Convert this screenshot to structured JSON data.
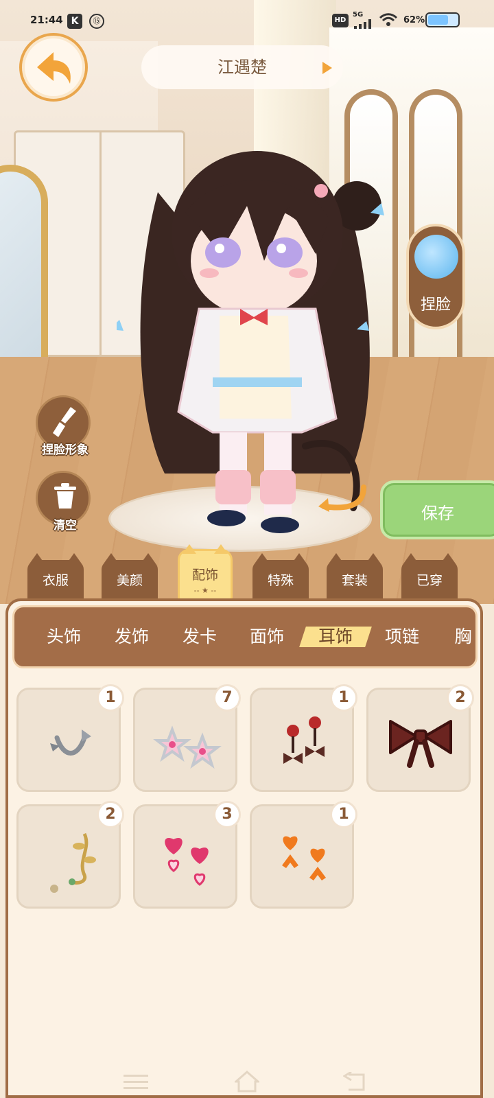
{
  "status": {
    "time": "21:44",
    "k_icon": "K",
    "circle_icon": "⑮",
    "hd": "HD",
    "network": "5G",
    "battery": "62%",
    "battery_level": 0.62
  },
  "header": {
    "back_icon": "back-arrow-icon",
    "character_name": "江遇楚",
    "play_icon": "play-triangle-icon"
  },
  "side_actions": {
    "face_button_label": "捏脸",
    "face_avatar_icon": "chibi-avatar-icon",
    "face_image_label": "捏脸形象",
    "brush_icon": "brush-icon",
    "clear_label": "清空",
    "trash_icon": "trash-icon",
    "save_label": "保存",
    "rotate_icon": "rotate-arrow-icon"
  },
  "categories": [
    {
      "label": "衣服",
      "active": false
    },
    {
      "label": "美颜",
      "active": false
    },
    {
      "label": "配饰",
      "active": true,
      "decoration": "-- ★ --"
    },
    {
      "label": "特殊",
      "active": false
    },
    {
      "label": "套装",
      "active": false
    },
    {
      "label": "已穿",
      "active": false
    }
  ],
  "subcategories": [
    {
      "label": "头饰",
      "active": false
    },
    {
      "label": "发饰",
      "active": false
    },
    {
      "label": "发卡",
      "active": false
    },
    {
      "label": "面饰",
      "active": false
    },
    {
      "label": "耳饰",
      "active": true
    },
    {
      "label": "项链",
      "active": false
    },
    {
      "label": "胸",
      "active": false
    }
  ],
  "items": [
    {
      "count": "1",
      "icon": "silver-hook-earring-icon"
    },
    {
      "count": "7",
      "icon": "pink-star-earring-icon"
    },
    {
      "count": "1",
      "icon": "apple-bow-earring-icon"
    },
    {
      "count": "2",
      "icon": "dark-bow-earring-icon"
    },
    {
      "count": "2",
      "icon": "gold-vine-earring-icon"
    },
    {
      "count": "3",
      "icon": "pink-heart-earring-icon"
    },
    {
      "count": "1",
      "icon": "orange-heart-bow-earring-icon"
    }
  ],
  "colors": {
    "panel_brown": "#a36d48",
    "active_yellow": "#fbe08e",
    "save_green": "#9bd57a",
    "accent_orange": "#e9a64d"
  }
}
